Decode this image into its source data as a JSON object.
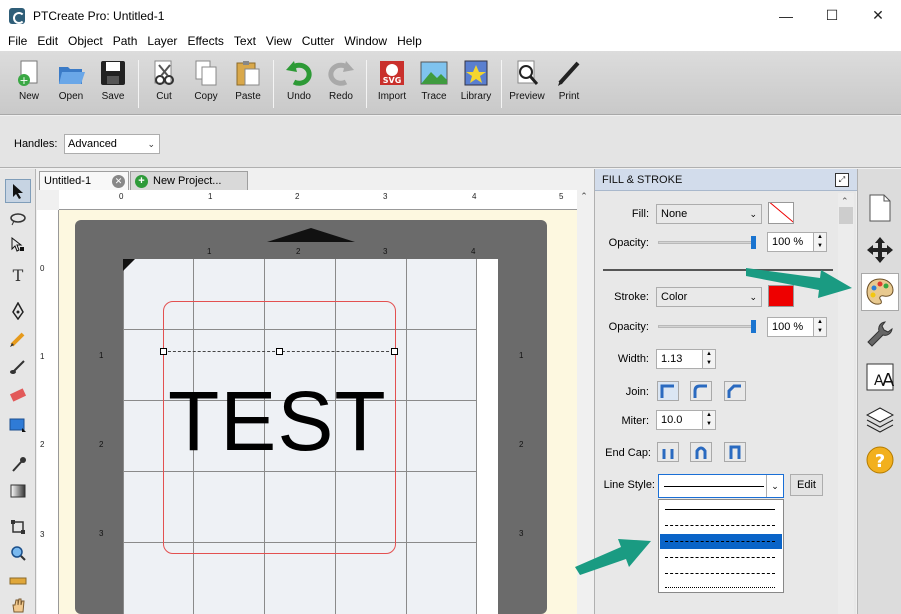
{
  "window": {
    "title": "PTCreate Pro: Untitled-1",
    "minimize": "—",
    "maximize": "☐",
    "close": "✕"
  },
  "menu": [
    "File",
    "Edit",
    "Object",
    "Path",
    "Layer",
    "Effects",
    "Text",
    "View",
    "Cutter",
    "Window",
    "Help"
  ],
  "toolbar": {
    "new": "New",
    "open": "Open",
    "save": "Save",
    "cut": "Cut",
    "copy": "Copy",
    "paste": "Paste",
    "undo": "Undo",
    "redo": "Redo",
    "import": "Import",
    "trace": "Trace",
    "library": "Library",
    "preview": "Preview",
    "print": "Print"
  },
  "handles": {
    "label": "Handles:",
    "value": "Advanced"
  },
  "tabs": {
    "untitled": "Untitled-1",
    "new_project": "New Project..."
  },
  "rulers": {
    "top": [
      "0",
      "1",
      "2",
      "3",
      "4",
      "5"
    ],
    "left": [
      "0",
      "1",
      "2",
      "3"
    ],
    "mat_top": [
      "1",
      "2",
      "3",
      "4"
    ],
    "mat_left": [
      "1",
      "2",
      "3"
    ]
  },
  "canvas": {
    "text": "TEST"
  },
  "panel": {
    "title": "FILL & STROKE",
    "fill_label": "Fill:",
    "fill_value": "None",
    "fill_opacity_label": "Opacity:",
    "fill_opacity_value": "100 %",
    "stroke_label": "Stroke:",
    "stroke_value": "Color",
    "stroke_color": "#ee0000",
    "stroke_opacity_label": "Opacity:",
    "stroke_opacity_value": "100 %",
    "width_label": "Width:",
    "width_value": "1.13",
    "join_label": "Join:",
    "miter_label": "Miter:",
    "miter_value": "10.0",
    "endcap_label": "End Cap:",
    "linestyle_label": "Line Style:",
    "edit_label": "Edit"
  },
  "accent": "#1a9b82"
}
